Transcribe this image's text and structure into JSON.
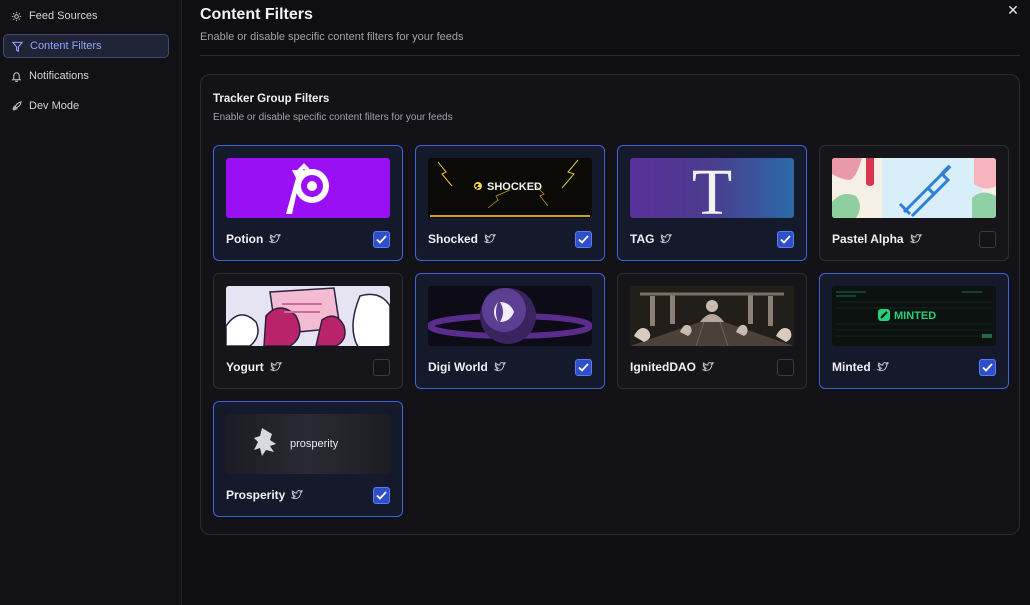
{
  "sidebar": {
    "items": [
      {
        "label": "Feed Sources",
        "icon": "gear-icon",
        "active": false
      },
      {
        "label": "Content Filters",
        "icon": "filter-icon",
        "active": true
      },
      {
        "label": "Notifications",
        "icon": "bell-icon",
        "active": false
      },
      {
        "label": "Dev Mode",
        "icon": "rocket-icon",
        "active": false
      }
    ]
  },
  "header": {
    "title": "Content Filters",
    "subtitle": "Enable or disable specific content filters for your feeds",
    "close_icon": "close-icon"
  },
  "panel": {
    "title": "Tracker Group Filters",
    "subtitle": "Enable or disable specific content filters for your feeds"
  },
  "colors": {
    "accent": "#3f63d8",
    "checkbox_on": "#2f4fc8",
    "background": "#0f0f12"
  },
  "cards": [
    {
      "name": "Potion",
      "checked": true,
      "logo_text": ""
    },
    {
      "name": "Shocked",
      "checked": true,
      "logo_text": "SHOCKED"
    },
    {
      "name": "TAG",
      "checked": true,
      "logo_text": "T"
    },
    {
      "name": "Pastel Alpha",
      "checked": false,
      "logo_text": ""
    },
    {
      "name": "Yogurt",
      "checked": false,
      "logo_text": ""
    },
    {
      "name": "Digi World",
      "checked": true,
      "logo_text": ""
    },
    {
      "name": "IgnitedDAO",
      "checked": false,
      "logo_text": ""
    },
    {
      "name": "Minted",
      "checked": true,
      "logo_text": "MINTED"
    },
    {
      "name": "Prosperity",
      "checked": true,
      "logo_text": "prosperity"
    }
  ]
}
